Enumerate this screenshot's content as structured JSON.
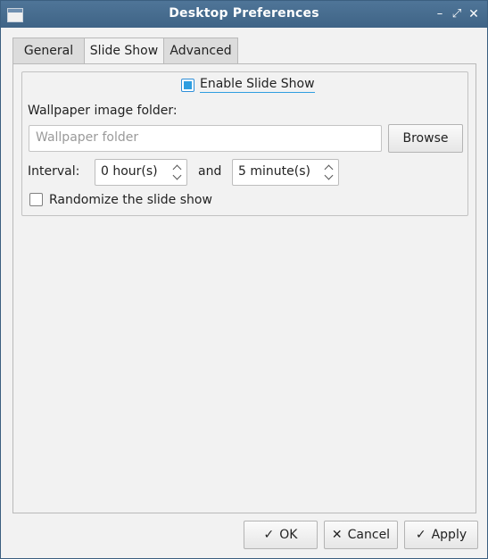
{
  "window": {
    "title": "Desktop Preferences"
  },
  "tabs": [
    {
      "label": "General"
    },
    {
      "label": "Slide Show",
      "active": true
    },
    {
      "label": "Advanced"
    }
  ],
  "slideshow": {
    "enable_label": "Enable Slide Show",
    "enable_checked": true,
    "folder_label": "Wallpaper image folder:",
    "folder_value": "",
    "folder_placeholder": "Wallpaper folder",
    "browse_label": "Browse",
    "interval_label": "Interval:",
    "hours_value": "0 hour(s)",
    "and_label": "and",
    "minutes_value": "5 minute(s)",
    "randomize_label": "Randomize the slide show",
    "randomize_checked": false
  },
  "buttons": {
    "ok": "OK",
    "cancel": "Cancel",
    "apply": "Apply"
  },
  "icons": {
    "app": "window-app-icon",
    "minimize": "minimize-icon",
    "maximize": "maximize-icon",
    "close": "close-icon",
    "ok": "check-icon",
    "cancel": "x-icon",
    "apply": "check-icon"
  },
  "colors": {
    "titlebar": "#4a6d8c",
    "accent": "#2f9ee0"
  }
}
